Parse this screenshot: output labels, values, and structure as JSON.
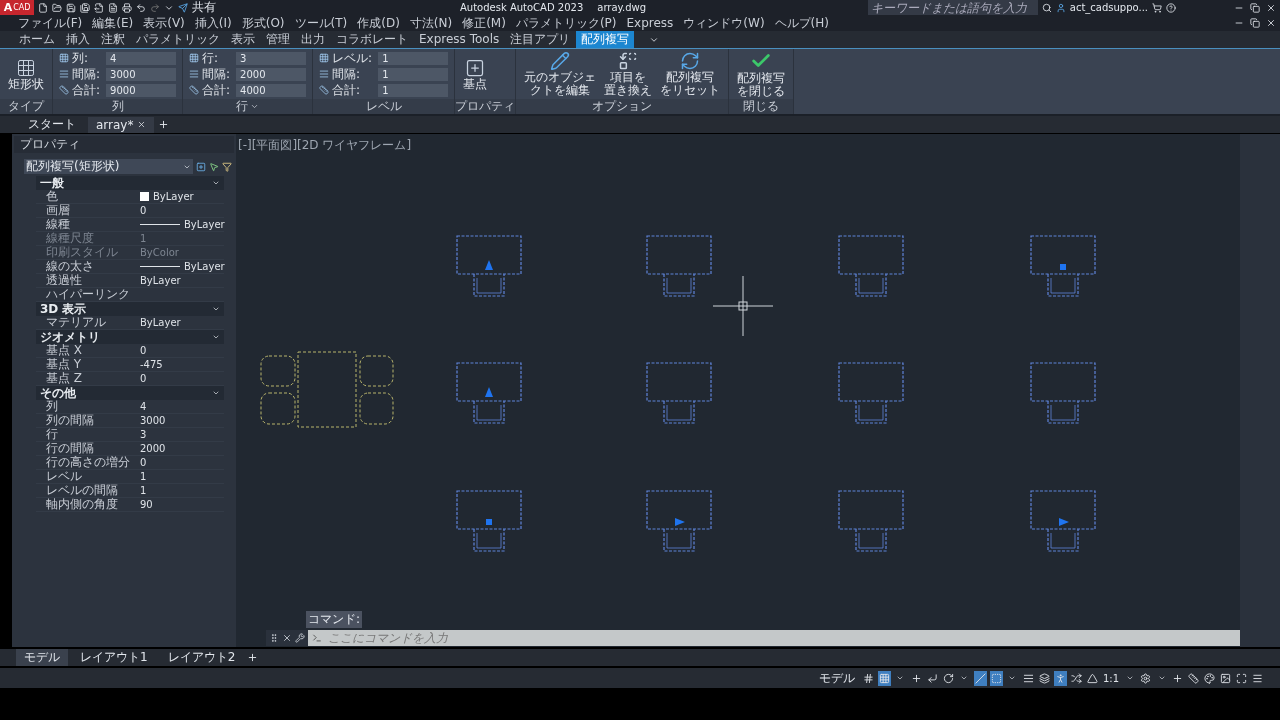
{
  "title_bar": {
    "app_letter": "A",
    "app_badge": "CAD",
    "share": "共有",
    "title": "Autodesk AutoCAD 2023",
    "filename": "array.dwg",
    "search": {
      "placeholder": "キーワードまたは語句を入力"
    },
    "user": "act_cadsuppo..."
  },
  "menu": [
    "ファイル(F)",
    "編集(E)",
    "表示(V)",
    "挿入(I)",
    "形式(O)",
    "ツール(T)",
    "作成(D)",
    "寸法(N)",
    "修正(M)",
    "パラメトリック(P)",
    "Express",
    "ウィンドウ(W)",
    "ヘルプ(H)"
  ],
  "ribbon_tabs": [
    {
      "label": "ホーム",
      "selected": false
    },
    {
      "label": "挿入",
      "selected": false
    },
    {
      "label": "注釈",
      "selected": false
    },
    {
      "label": "パラメトリック",
      "selected": false
    },
    {
      "label": "表示",
      "selected": false
    },
    {
      "label": "管理",
      "selected": false
    },
    {
      "label": "出力",
      "selected": false
    },
    {
      "label": "コラボレート",
      "selected": false
    },
    {
      "label": "Express Tools",
      "selected": false
    },
    {
      "label": "注目アプリ",
      "selected": false
    },
    {
      "label": "配列複写",
      "selected": true
    }
  ],
  "ribbon": {
    "panels": [
      {
        "kind": "buttons",
        "title": "タイプ",
        "buttons": [
          {
            "kind": "rect-array",
            "lines": [
              "矩形状"
            ]
          }
        ]
      },
      {
        "kind": "fields",
        "title": "列",
        "has_menu": false,
        "fields": [
          {
            "kind": "count",
            "label": "列:",
            "value": "4"
          },
          {
            "kind": "spacing",
            "label": "間隔:",
            "value": "3000"
          },
          {
            "kind": "total",
            "label": "合計:",
            "value": "9000"
          }
        ]
      },
      {
        "kind": "fields",
        "title": "行",
        "has_menu": true,
        "fields": [
          {
            "kind": "count",
            "label": "行:",
            "value": "3"
          },
          {
            "kind": "spacing",
            "label": "間隔:",
            "value": "2000"
          },
          {
            "kind": "total",
            "label": "合計:",
            "value": "4000"
          }
        ]
      },
      {
        "kind": "fields",
        "title": "レベル",
        "has_menu": false,
        "fields": [
          {
            "kind": "count",
            "label": "レベル:",
            "value": "1"
          },
          {
            "kind": "spacing",
            "label": "間隔:",
            "value": "1"
          },
          {
            "kind": "total",
            "label": "合計:",
            "value": "1"
          }
        ]
      },
      {
        "kind": "buttons",
        "title": "プロパティ",
        "buttons": [
          {
            "kind": "base-point",
            "lines": [
              "基点"
            ]
          }
        ]
      },
      {
        "kind": "buttons",
        "title": "オプション",
        "buttons": [
          {
            "kind": "edit",
            "lines": [
              "元のオブジェ",
              "クトを編集"
            ]
          },
          {
            "kind": "replace",
            "lines": [
              "項目を",
              "置き換え"
            ]
          },
          {
            "kind": "reset",
            "lines": [
              "配列複写",
              "をリセット"
            ]
          }
        ]
      },
      {
        "kind": "buttons",
        "title": "閉じる",
        "buttons": [
          {
            "kind": "check",
            "lines": [
              "配列複写",
              "を閉じる"
            ]
          }
        ]
      }
    ]
  },
  "doc_tabs": [
    {
      "label": "スタート",
      "selected": false
    },
    {
      "label": "array*",
      "selected": true
    }
  ],
  "properties": {
    "title": "プロパティ",
    "object_type": "配列複写(矩形状)",
    "sections": [
      {
        "title": "一般",
        "expanded": true,
        "rows": [
          {
            "kind": "color",
            "label": "色",
            "value": "ByLayer",
            "disabled": false
          },
          {
            "kind": "text",
            "label": "画層",
            "value": "0",
            "disabled": false
          },
          {
            "kind": "line",
            "label": "線種",
            "value": "ByLayer",
            "disabled": false
          },
          {
            "kind": "text",
            "label": "線種尺度",
            "value": "1",
            "disabled": true
          },
          {
            "kind": "text",
            "label": "印刷スタイル",
            "value": "ByColor",
            "disabled": true
          },
          {
            "kind": "line",
            "label": "線の太さ",
            "value": "ByLayer",
            "disabled": false
          },
          {
            "kind": "text",
            "label": "透過性",
            "value": "ByLayer",
            "disabled": false
          },
          {
            "label": "ハイパーリンク",
            "disabled": false
          }
        ]
      },
      {
        "title": "3D 表示",
        "expanded": true,
        "rows": [
          {
            "kind": "text",
            "label": "マテリアル",
            "value": "ByLayer",
            "disabled": false
          }
        ]
      },
      {
        "title": "ジオメトリ",
        "expanded": true,
        "rows": [
          {
            "kind": "text",
            "label": "基点 X",
            "value": "0",
            "disabled": false
          },
          {
            "kind": "text",
            "label": "基点 Y",
            "value": "-475",
            "disabled": false
          },
          {
            "kind": "text",
            "label": "基点 Z",
            "value": "0",
            "disabled": false
          }
        ]
      },
      {
        "title": "その他",
        "expanded": true,
        "rows": [
          {
            "kind": "text",
            "label": "列",
            "value": "4",
            "disabled": false
          },
          {
            "kind": "text",
            "label": "列の間隔",
            "value": "3000",
            "disabled": false
          },
          {
            "kind": "text",
            "label": "行",
            "value": "3",
            "disabled": false
          },
          {
            "kind": "text",
            "label": "行の間隔",
            "value": "2000",
            "disabled": false
          },
          {
            "kind": "text",
            "label": "行の高さの増分",
            "value": "0",
            "disabled": false
          },
          {
            "kind": "text",
            "label": "レベル",
            "value": "1",
            "disabled": false
          },
          {
            "kind": "text",
            "label": "レベルの間隔",
            "value": "1",
            "disabled": false
          },
          {
            "kind": "text",
            "label": "軸内側の角度",
            "value": "90",
            "disabled": false
          }
        ]
      }
    ]
  },
  "viewport_label": "[-][平面図][2D ワイヤフレーム]",
  "command": {
    "prompt": "コマンド:",
    "placeholder": "ここにコマンドを入力"
  },
  "layout_tabs": [
    {
      "label": "モデル",
      "selected": true
    },
    {
      "label": "レイアウト1",
      "selected": false
    },
    {
      "label": "レイアウト2",
      "selected": false
    }
  ],
  "status_bar": {
    "model": "モデル",
    "tools": [
      {
        "kind": "grid",
        "on": false
      },
      {
        "kind": "snap",
        "on": true
      },
      {
        "kind": "menu",
        "on": false
      },
      {
        "kind": "infer",
        "on": false
      },
      {
        "kind": "ortho",
        "on": false
      },
      {
        "kind": "polar",
        "on": false
      },
      {
        "kind": "menu",
        "on": false
      },
      {
        "kind": "isodraft",
        "on": true
      },
      {
        "kind": "osnap",
        "on": true
      },
      {
        "kind": "menu",
        "on": false
      },
      {
        "kind": "lineweight",
        "on": false
      },
      {
        "kind": "transparency",
        "on": false
      },
      {
        "kind": "annovis",
        "on": true
      },
      {
        "kind": "autoscale",
        "on": false
      },
      {
        "kind": "annoscale",
        "on": false
      },
      {
        "kind": "scale",
        "label": "1:1",
        "on": false
      },
      {
        "kind": "menu",
        "on": false
      },
      {
        "kind": "settings",
        "on": false
      },
      {
        "kind": "menu",
        "on": false
      },
      {
        "kind": "plus",
        "on": false
      },
      {
        "kind": "units",
        "on": false
      },
      {
        "kind": "isolate",
        "on": false
      },
      {
        "kind": "graphics",
        "on": false
      },
      {
        "kind": "fullscreen",
        "on": false
      },
      {
        "kind": "customize",
        "on": false
      }
    ]
  }
}
